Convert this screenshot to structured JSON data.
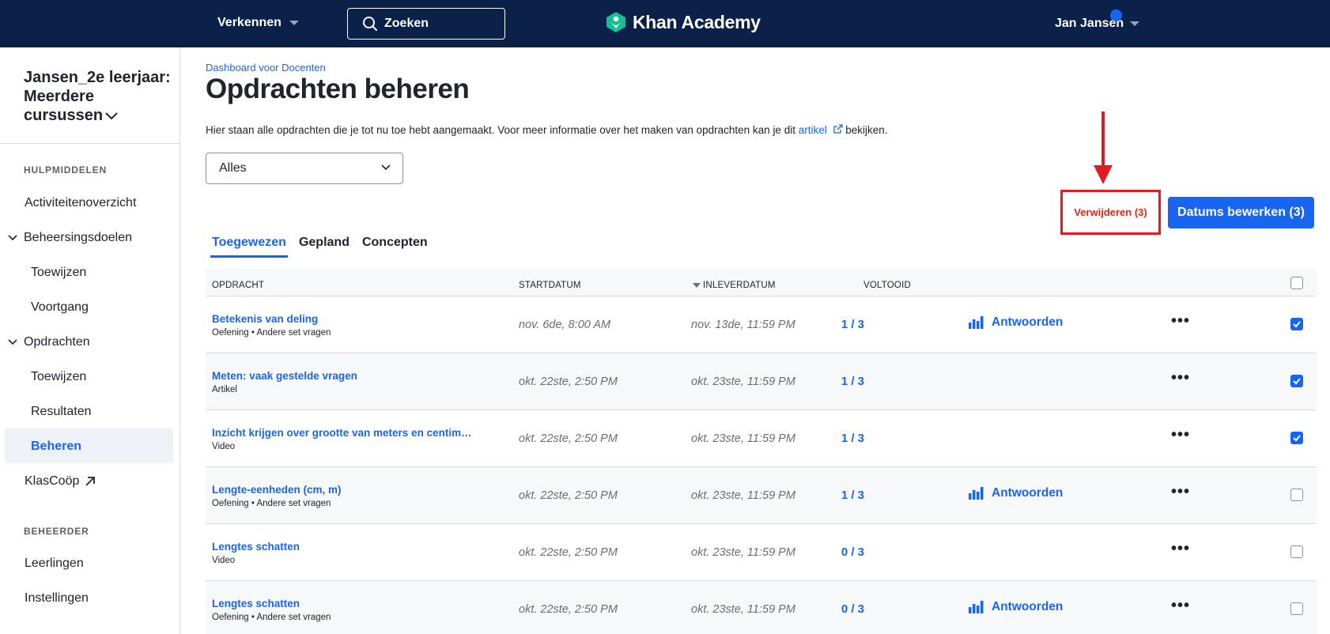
{
  "topbar": {
    "explore_label": "Verkennen",
    "search_label": "Zoeken",
    "logo_text": "Khan Academy",
    "user_name": "Jan Jansen"
  },
  "sidebar": {
    "class_name_line1": "Jansen_2e leerjaar:",
    "class_name_line2": "Meerdere",
    "class_name_line3": "cursussen",
    "section_tools": "HULPMIDDELEN",
    "activity_overview": "Activiteitenoverzicht",
    "mastery_goals": "Beheersingsdoelen",
    "mastery_assign": "Toewijzen",
    "mastery_progress": "Voortgang",
    "assignments": "Opdrachten",
    "assignments_assign": "Toewijzen",
    "assignments_results": "Resultaten",
    "assignments_manage": "Beheren",
    "klascoop": "KlasCoöp",
    "section_admin": "BEHEERDER",
    "students": "Leerlingen",
    "settings": "Instellingen"
  },
  "main": {
    "breadcrumb": "Dashboard voor Docenten",
    "title": "Opdrachten beheren",
    "desc_before": "Hier staan alle opdrachten die je tot nu toe hebt aangemaakt. Voor meer informatie over het maken van opdrachten kan je dit ",
    "desc_link": "artikel",
    "desc_after": " bekijken.",
    "filter_value": "Alles",
    "delete_button": "Verwijderen (3)",
    "edit_dates_button": "Datums bewerken (3)",
    "tabs": [
      "Toegewezen",
      "Gepland",
      "Concepten"
    ],
    "active_tab": "Toegewezen"
  },
  "table": {
    "headers": {
      "assignment": "OPDRACHT",
      "start_date": "STARTDATUM",
      "due_date": "INLEVERDATUM",
      "completed": "VOLTOOID"
    },
    "answers_label": "Antwoorden",
    "rows": [
      {
        "title": "Betekenis van deling",
        "type": "Oefening • Andere set vragen",
        "start": "nov. 6de, 8:00 AM",
        "due": "nov. 13de, 11:59 PM",
        "done": "1 / 3",
        "answers": true,
        "checked": true
      },
      {
        "title": "Meten: vaak gestelde vragen",
        "type": "Artikel",
        "start": "okt. 22ste, 2:50 PM",
        "due": "okt. 23ste, 11:59 PM",
        "done": "1 / 3",
        "answers": false,
        "checked": true
      },
      {
        "title": "Inzicht krijgen over grootte van meters en centim…",
        "type": "Video",
        "start": "okt. 22ste, 2:50 PM",
        "due": "okt. 23ste, 11:59 PM",
        "done": "1 / 3",
        "answers": false,
        "checked": true
      },
      {
        "title": "Lengte-eenheden (cm, m)",
        "type": "Oefening • Andere set vragen",
        "start": "okt. 22ste, 2:50 PM",
        "due": "okt. 23ste, 11:59 PM",
        "done": "1 / 3",
        "answers": true,
        "checked": false
      },
      {
        "title": "Lengtes schatten",
        "type": "Video",
        "start": "okt. 22ste, 2:50 PM",
        "due": "okt. 23ste, 11:59 PM",
        "done": "0 / 3",
        "answers": false,
        "checked": false
      },
      {
        "title": "Lengtes schatten",
        "type": "Oefening • Andere set vragen",
        "start": "okt. 22ste, 2:50 PM",
        "due": "okt. 23ste, 11:59 PM",
        "done": "0 / 3",
        "answers": true,
        "checked": false
      }
    ]
  },
  "colors": {
    "topbar": "#0b2149",
    "accent": "#1865f2",
    "delete": "#d92916",
    "annotation": "#e01b22"
  }
}
